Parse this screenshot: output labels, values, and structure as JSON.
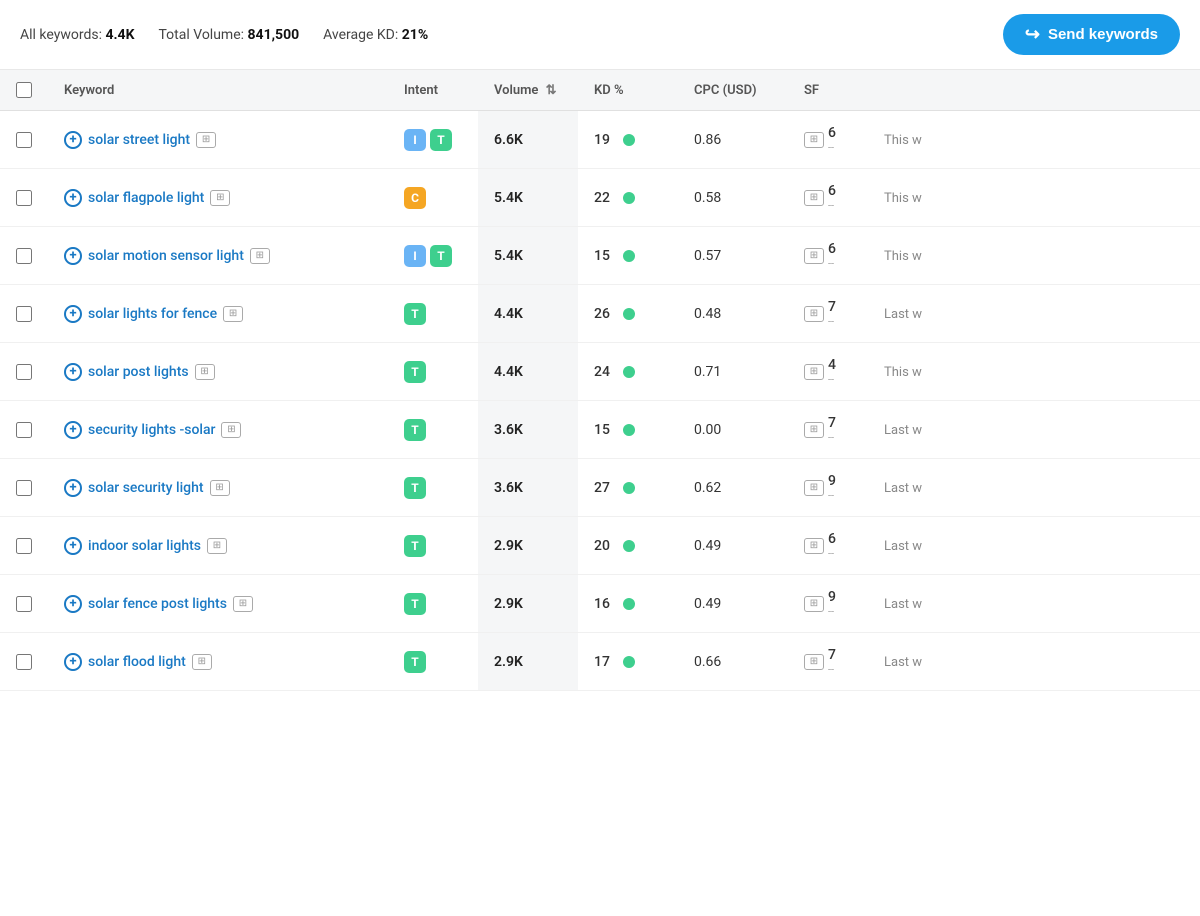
{
  "header": {
    "all_keywords_label": "All keywords:",
    "all_keywords_value": "4.4K",
    "total_volume_label": "Total Volume:",
    "total_volume_value": "841,500",
    "avg_kd_label": "Average KD:",
    "avg_kd_value": "21%",
    "send_keywords_btn": "Send keywords"
  },
  "table": {
    "columns": [
      {
        "id": "checkbox",
        "label": ""
      },
      {
        "id": "keyword",
        "label": "Keyword"
      },
      {
        "id": "intent",
        "label": "Intent"
      },
      {
        "id": "volume",
        "label": "Volume",
        "sortable": true
      },
      {
        "id": "kd",
        "label": "KD %"
      },
      {
        "id": "cpc",
        "label": "CPC (USD)"
      },
      {
        "id": "sf",
        "label": "SF"
      },
      {
        "id": "extra",
        "label": ""
      }
    ],
    "rows": [
      {
        "keyword": "solar street light",
        "intents": [
          "I",
          "T"
        ],
        "volume": "6.6K",
        "kd": 19,
        "cpc": "0.86",
        "sf": "6",
        "sf_sub": "--",
        "extra": "This w"
      },
      {
        "keyword": "solar flagpole light",
        "intents": [
          "C"
        ],
        "volume": "5.4K",
        "kd": 22,
        "cpc": "0.58",
        "sf": "6",
        "sf_sub": "--",
        "extra": "This w"
      },
      {
        "keyword": "solar motion sensor light",
        "intents": [
          "I",
          "T"
        ],
        "volume": "5.4K",
        "kd": 15,
        "cpc": "0.57",
        "sf": "6",
        "sf_sub": "--",
        "extra": "This w"
      },
      {
        "keyword": "solar lights for fence",
        "intents": [
          "T"
        ],
        "volume": "4.4K",
        "kd": 26,
        "cpc": "0.48",
        "sf": "7",
        "sf_sub": "--",
        "extra": "Last w"
      },
      {
        "keyword": "solar post lights",
        "intents": [
          "T"
        ],
        "volume": "4.4K",
        "kd": 24,
        "cpc": "0.71",
        "sf": "4",
        "sf_sub": "--",
        "extra": "This w"
      },
      {
        "keyword": "security lights -solar",
        "intents": [
          "T"
        ],
        "volume": "3.6K",
        "kd": 15,
        "cpc": "0.00",
        "sf": "7",
        "sf_sub": "--",
        "extra": "Last w"
      },
      {
        "keyword": "solar security light",
        "intents": [
          "T"
        ],
        "volume": "3.6K",
        "kd": 27,
        "cpc": "0.62",
        "sf": "9",
        "sf_sub": "--",
        "extra": "Last w"
      },
      {
        "keyword": "indoor solar lights",
        "intents": [
          "T"
        ],
        "volume": "2.9K",
        "kd": 20,
        "cpc": "0.49",
        "sf": "6",
        "sf_sub": "--",
        "extra": "Last w"
      },
      {
        "keyword": "solar fence post lights",
        "intents": [
          "T"
        ],
        "volume": "2.9K",
        "kd": 16,
        "cpc": "0.49",
        "sf": "9",
        "sf_sub": "--",
        "extra": "Last w"
      },
      {
        "keyword": "solar flood light",
        "intents": [
          "T"
        ],
        "volume": "2.9K",
        "kd": 17,
        "cpc": "0.66",
        "sf": "7",
        "sf_sub": "--",
        "extra": "Last w"
      }
    ]
  }
}
